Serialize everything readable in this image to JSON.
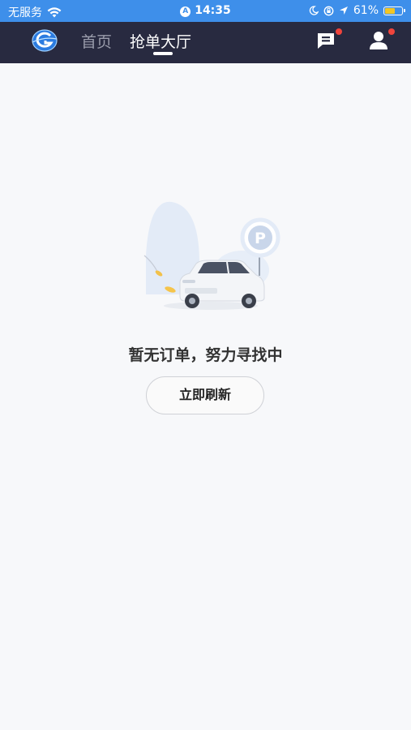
{
  "status_bar": {
    "carrier": "无服务",
    "time": "14:35",
    "battery_percent": "61%",
    "battery_level": 0.61,
    "icons": [
      "wifi-icon",
      "location-lock-icon",
      "moon-icon",
      "rotation-lock-icon",
      "location-arrow-icon",
      "battery-icon"
    ]
  },
  "nav": {
    "logo": "app-logo",
    "tabs": [
      {
        "label": "首页",
        "active": false
      },
      {
        "label": "抢单大厅",
        "active": true
      }
    ],
    "message_icon": "message-icon",
    "user_icon": "user-icon",
    "badge_color": "#f0443c"
  },
  "empty_state": {
    "illustration": "car-parking-illustration",
    "message": "暂无订单，努力寻找中",
    "refresh_label": "立即刷新"
  },
  "colors": {
    "status_bar_bg": "#3e8fea",
    "nav_bg": "#282a40",
    "page_bg": "#f7f8fa"
  }
}
